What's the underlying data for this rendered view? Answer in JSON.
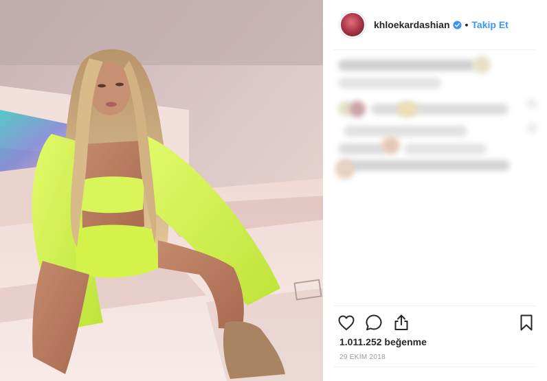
{
  "post": {
    "username": "khloekardashian",
    "verified": true,
    "separator": "•",
    "follow_label": "Takip Et",
    "likes_text": "1.011.252 beğenme",
    "date_text": "29 EKİM 2018"
  },
  "actions": {
    "icons": [
      "heart-icon",
      "comment-icon",
      "share-icon",
      "bookmark-icon"
    ]
  },
  "colors": {
    "link": "#3897f0",
    "verified": "#3897f0",
    "text": "#262626",
    "muted": "#999999",
    "divider": "#efefef",
    "outfit_neon": "#d4f34a"
  }
}
